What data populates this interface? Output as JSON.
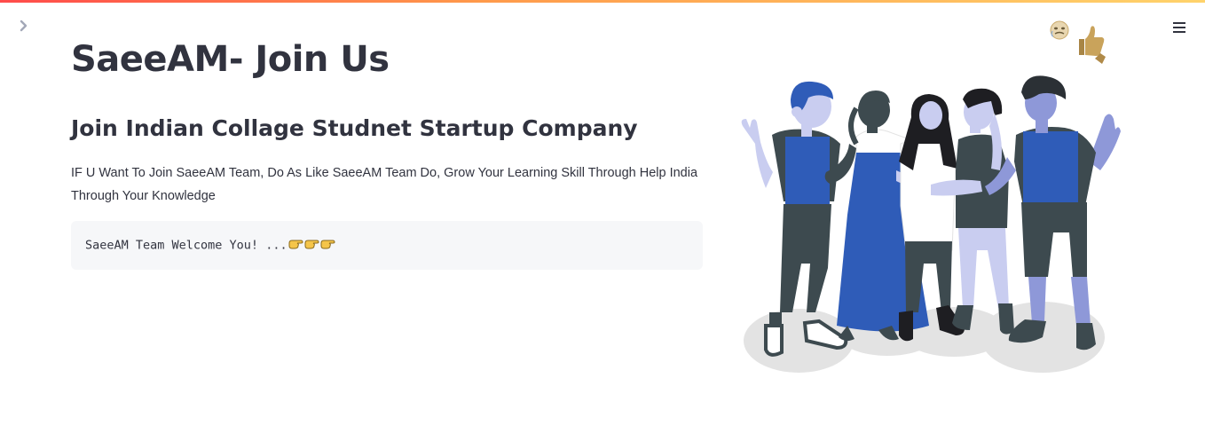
{
  "header": {
    "accent_gradient": [
      "#ff4b4b",
      "#ffd36b"
    ],
    "sidebar_toggle_icon": "chevron-right-icon",
    "menu_icon": "hamburger-menu-icon",
    "status_icons": [
      "running-face-icon",
      "thumbs-up-icon"
    ]
  },
  "main": {
    "title": "SaeeAM- Join Us",
    "subheader": "Join Indian Collage Studnet Startup Company",
    "body_text": "IF U Want To Join SaeeAM Team, Do As Like SaeeAM Team Do, Grow Your Learning Skill Through Help India Through Your Knowledge",
    "code_text": "SaeeAM Team Welcome You! ...",
    "code_icons": [
      "pointing-hand-icon",
      "pointing-hand-icon",
      "pointing-hand-icon"
    ]
  },
  "illustration": {
    "name": "group-of-people-illustration",
    "colors": {
      "blue": "#2f5cb8",
      "dark": "#3d4a4f",
      "light": "#c9cdf0",
      "shadow": "#e3e3e3"
    }
  }
}
